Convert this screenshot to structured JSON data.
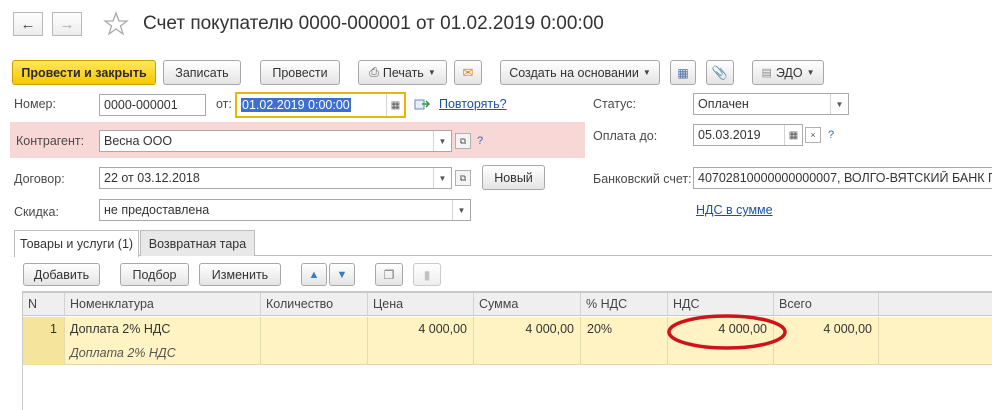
{
  "header": {
    "title": "Счет покупателю 0000-000001 от 01.02.2019 0:00:00",
    "back_icon": "arrow-left-icon",
    "forward_icon": "arrow-right-icon",
    "favorite_icon": "star-icon"
  },
  "toolbar": {
    "post_close": "Провести и закрыть",
    "save": "Записать",
    "post": "Провести",
    "print": "Печать",
    "create_based": "Создать на основании",
    "edo": "ЭДО"
  },
  "form": {
    "number_label": "Номер:",
    "number_value": "0000-000001",
    "date_label": "от:",
    "date_value": "01.02.2019  0:00:00",
    "repeat_link": "Повторять?",
    "status_label": "Статус:",
    "status_value": "Оплачен",
    "contractor_label": "Контрагент:",
    "contractor_value": "Весна ООО",
    "pay_until_label": "Оплата до:",
    "pay_until_value": "05.03.2019",
    "contract_label": "Договор:",
    "contract_value": "22 от 03.12.2018",
    "new_button": "Новый",
    "bank_label": "Банковский счет:",
    "bank_value": "40702810000000000007, ВОЛГО-ВЯТСКИЙ БАНК П...",
    "discount_label": "Скидка:",
    "discount_value": "не предоставлена",
    "vat_link": "НДС в сумме",
    "help_mark": "?"
  },
  "tabs": [
    {
      "label": "Товары и услуги (1)"
    },
    {
      "label": "Возвратная тара"
    }
  ],
  "table_toolbar": {
    "add": "Добавить",
    "select": "Подбор",
    "change": "Изменить"
  },
  "table": {
    "columns": [
      "N",
      "Номенклатура",
      "Количество",
      "Цена",
      "Сумма",
      "% НДС",
      "НДС",
      "Всего"
    ],
    "rows": [
      {
        "n": "1",
        "item": "Доплата 2% НДС",
        "item_desc": "Доплата 2% НДС",
        "qty": "",
        "price": "4 000,00",
        "sum": "4 000,00",
        "vat_rate": "20%",
        "vat": "4 000,00",
        "total": "4 000,00"
      }
    ]
  },
  "colors": {
    "primary_button": "#f5c800",
    "highlight_row": "#fff3c4",
    "error_field_bg": "#f8d7d7",
    "annotation_ellipse": "#d0121b",
    "link": "#1f4fa8"
  }
}
